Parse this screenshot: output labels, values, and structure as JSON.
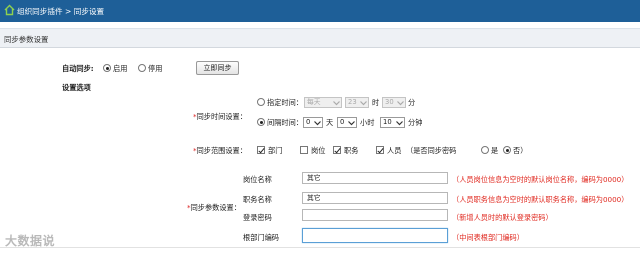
{
  "header": {
    "breadcrumb_root": "组织同步插件",
    "breadcrumb_sep": ">",
    "breadcrumb_current": "同步设置"
  },
  "section": {
    "title": "同步参数设置"
  },
  "auto_sync": {
    "label": "自动同步:",
    "options": [
      {
        "label": "启用",
        "selected": true
      },
      {
        "label": "停用",
        "selected": false
      }
    ],
    "sync_now_button": "立即同步"
  },
  "settings": {
    "group_label": "设置选项",
    "time": {
      "required_mark": "*",
      "label": "同步时间设置：",
      "fixed": {
        "label": "指定时间：",
        "selected": false,
        "day_value": "每天",
        "hour_value": "23",
        "hour_unit": "时",
        "minute_value": "30",
        "minute_unit": "分"
      },
      "interval": {
        "label": "间隔时间：",
        "selected": true,
        "day_value": "0",
        "day_unit": "天",
        "hour_value": "0",
        "hour_unit": "小时",
        "minute_value": "10",
        "minute_unit": "分钟"
      }
    },
    "scope": {
      "required_mark": "*",
      "label": "同步范围设置：",
      "items": [
        {
          "label": "部门",
          "checked": true
        },
        {
          "label": "岗位",
          "checked": false
        },
        {
          "label": "职务",
          "checked": true
        },
        {
          "label": "人员",
          "checked": true
        }
      ],
      "password_question": "（是否同步密码",
      "yes_label": "是",
      "no_label": "否）",
      "password_sync": false
    },
    "params": {
      "required_mark": "*",
      "label": "同步参数设置：",
      "rows": [
        {
          "label": "岗位名称",
          "value": "其它",
          "hint": "（人员岗位信息为空时的默认岗位名称，编码为0000）"
        },
        {
          "label": "职务名称",
          "value": "其它",
          "hint": "（人员职务信息为空时的默认职务名称，编码为0000）"
        },
        {
          "label": "登录密码",
          "value": "",
          "hint": "（新增人员时的默认登录密码）"
        },
        {
          "label": "根部门编码",
          "value": "",
          "hint": "（中间表根部门编码）"
        }
      ]
    }
  },
  "watermark": "大数据说",
  "colors": {
    "header_bg": "#1e5f98",
    "hint_red": "#e0281f",
    "required_red": "#d22222"
  }
}
